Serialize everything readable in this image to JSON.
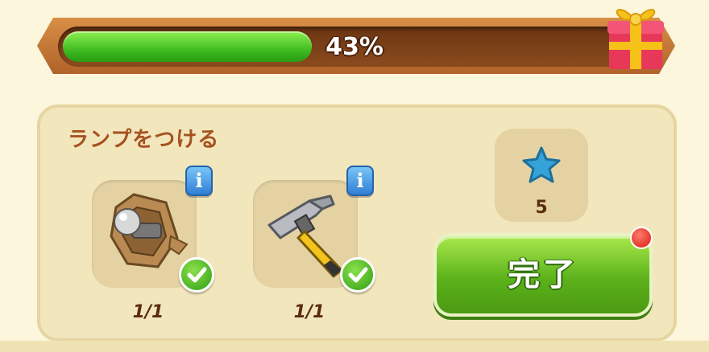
{
  "progress": {
    "label": "43%",
    "value": 0.43
  },
  "task": {
    "title": "ランプをつける",
    "items": [
      {
        "icon": "lamp-part-icon",
        "count": "1/1",
        "completed": true
      },
      {
        "icon": "hammer-icon",
        "count": "1/1",
        "completed": true
      }
    ]
  },
  "reward": {
    "icon": "blue-star-icon",
    "amount": "5"
  },
  "complete_button": {
    "label": "完了",
    "has_notification": true
  },
  "colors": {
    "progress_fill": "#3fbf1f",
    "complete_button": "#5cb21b",
    "title": "#a5521f",
    "panel": "#f2e6bd"
  }
}
